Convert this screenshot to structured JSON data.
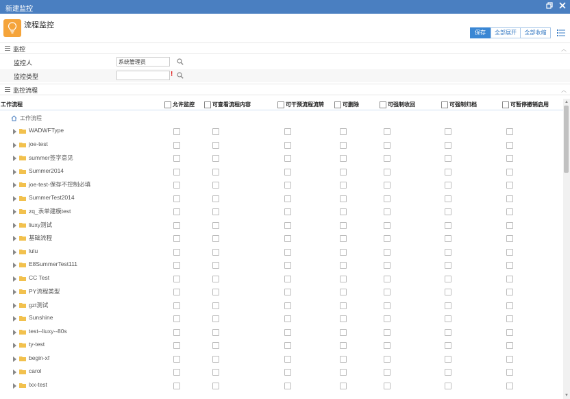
{
  "window": {
    "title": "新建监控"
  },
  "header": {
    "app_title": "流程监控",
    "icon": "lightbulb-icon"
  },
  "toolbar": {
    "save_label": "保存",
    "expand_label": "全部展开",
    "collapse_label": "全部收缩"
  },
  "sections": {
    "monitor": "监控",
    "monitor_flow": "监控流程"
  },
  "form": {
    "monitor_person_label": "监控人",
    "monitor_person_value": "系统管理员",
    "monitor_type_label": "监控类型",
    "monitor_type_value": "",
    "required_mark": "!"
  },
  "table": {
    "first_col": "工作流程",
    "columns": [
      "允许监控",
      "可查看流程内容",
      "可干预流程流转",
      "可删除",
      "可强制收回",
      "可强制归档",
      "可暂停撤销启用"
    ],
    "root": "工作流程",
    "rows": [
      "WADWFType",
      "joe-test",
      "summer签字意见",
      "Summer2014",
      "joe-test-保存不控制必填",
      "SummerTest2014",
      "zq_表单建模test",
      "liuxy测试",
      "基础流程",
      "lulu",
      "E8SummerTest111",
      "CC Test",
      "PY流程类型",
      "gzt测试",
      "Sunshine",
      "test--liuxy--80s",
      "ty-test",
      "begin-xf",
      "carol",
      "lxx-test"
    ]
  },
  "colors": {
    "titlebar": "#4a7fc1",
    "accent": "#3a87d4",
    "icon_bg": "#f5a43a",
    "folder": "#f2c14e"
  }
}
